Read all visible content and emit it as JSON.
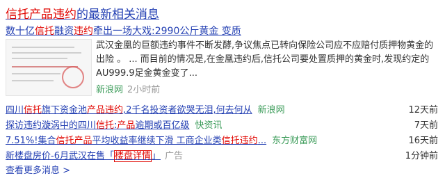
{
  "header": {
    "title_pre": "信托产品违约",
    "title_post": "的最新相关消息"
  },
  "top": {
    "title_pre": "数十亿",
    "title_red1": "信托",
    "title_mid": "融资",
    "title_red2": "违约",
    "title_post": "牵出一场大戏:2990公斤黄金 变质",
    "abstract": "武汉金凰的巨额违约事件不断发酵,争议焦点已转向保险公司应不应赔付质押物黄金的 出险 。 ... 而目前的情况是,在金凰违约后,信托公司要处置质押的黄金时,发现约定的AU999.9足金黄金变了...",
    "source": "新浪网",
    "time": "2小时前"
  },
  "news": [
    {
      "pre": "四川",
      "red": "信托",
      "mid": "旗下资金池",
      "red2": "产品违约",
      "post": ",2千名投资者欲哭无泪,何去何从",
      "source": "新浪网",
      "time": "12天前"
    },
    {
      "pre": "探访违约漩涡中的四川",
      "red": "信托",
      "mid": ":",
      "red2": "产品",
      "post": "逾期或百亿级",
      "source": "快资讯",
      "time": "7天前"
    },
    {
      "pre": "7.51%!集合",
      "red": "信托产品",
      "mid": "平均收益率继续下滑 工商企业类",
      "red2": "信托违约",
      "post": "...",
      "source": "东方财富网",
      "time": "16天前"
    }
  ],
  "ad": {
    "pre": "新楼盘房价-6月武汉在售「",
    "hl": "楼盘详情",
    "post": "」",
    "label": "广告",
    "time": "1分钟前"
  },
  "more": "查看更多消息 >"
}
